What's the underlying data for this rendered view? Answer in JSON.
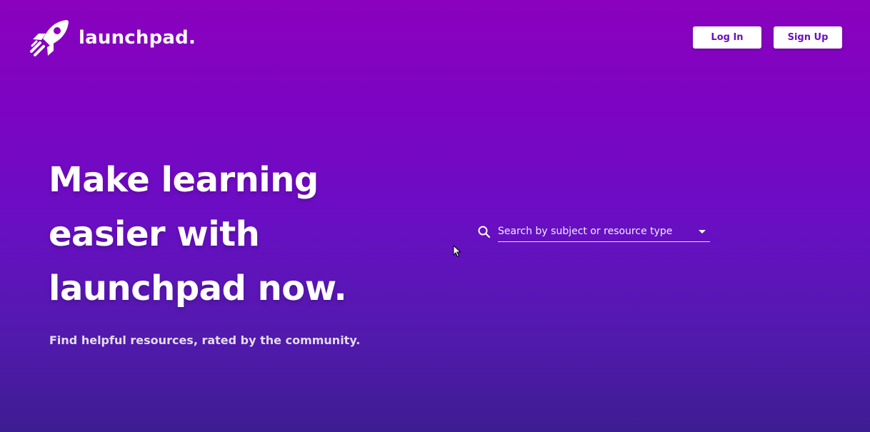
{
  "brand": {
    "name": "launchpad.",
    "logo_icon": "rocket-icon"
  },
  "header": {
    "login_label": "Log In",
    "signup_label": "Sign Up"
  },
  "hero": {
    "title_lines": [
      "Make learning",
      "easier with",
      "launchpad now."
    ],
    "subtitle": "Find helpful resources, rated by the community."
  },
  "search": {
    "placeholder": "Search by subject or resource type",
    "icon": "search-icon",
    "dropdown_icon": "chevron-down-icon"
  },
  "colors": {
    "gradient_top": "#8a02bd",
    "gradient_bottom": "#3d1d92",
    "button_text": "#6a0fbe",
    "button_bg": "#ffffff"
  }
}
